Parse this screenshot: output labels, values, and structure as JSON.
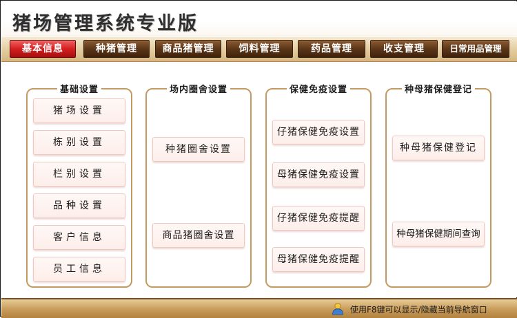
{
  "app": {
    "title": "猪场管理系统专业版"
  },
  "nav": {
    "tabs": [
      {
        "label": "基本信息",
        "active": true
      },
      {
        "label": "种猪管理",
        "active": false
      },
      {
        "label": "商品猪管理",
        "active": false
      },
      {
        "label": "饲料管理",
        "active": false
      },
      {
        "label": "药品管理",
        "active": false
      },
      {
        "label": "收支管理",
        "active": false
      },
      {
        "label": "日常用品管理",
        "active": false
      }
    ]
  },
  "panels": [
    {
      "title": "基础设置",
      "buttons": [
        "猪场设置",
        "栋别设置",
        "栏别设置",
        "品种设置",
        "客户信息",
        "员工信息"
      ]
    },
    {
      "title": "场内圈舍设置",
      "buttons": [
        "种猪圈舍设置",
        "商品猪圈舍设置"
      ]
    },
    {
      "title": "保健免疫设置",
      "buttons": [
        "仔猪保健免疫设置",
        "母猪保健免疫设置",
        "仔猪保健免疫提醒",
        "母猪保健免疫提醒"
      ]
    },
    {
      "title": "种母猪保健登记",
      "buttons": [
        "种母猪保健登记",
        "种母猪保健期间查询"
      ]
    }
  ],
  "status": {
    "icon": "user-icon",
    "text": "使用F8键可以显示/隐藏当前导航窗口"
  },
  "colors": {
    "tab_bg": "#5c3719",
    "tab_active": "#d42020",
    "panel_border": "#c39a62",
    "button_bg": "#fdeeea",
    "status_bg": "#c79a58"
  }
}
